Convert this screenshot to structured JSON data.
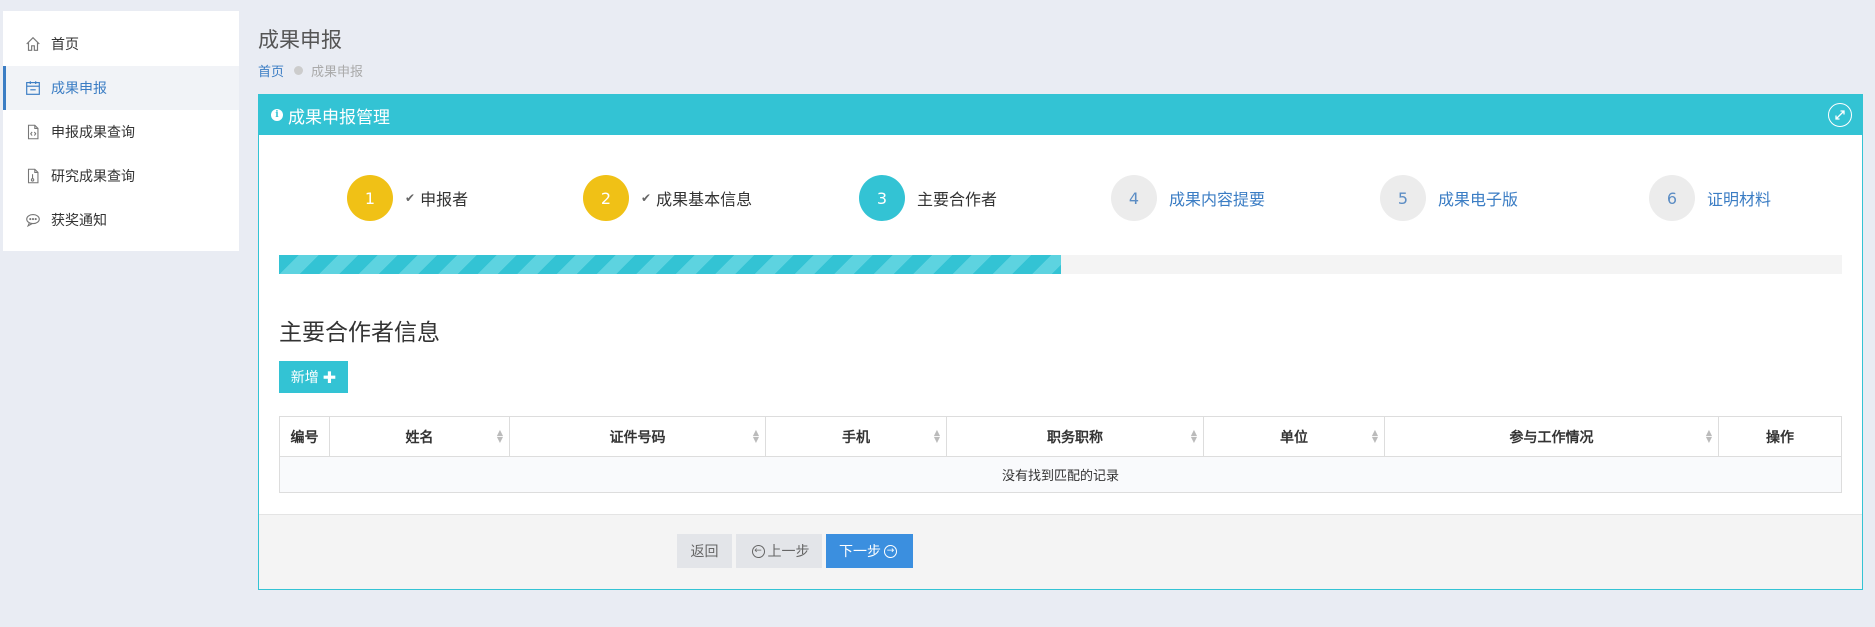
{
  "sidebar": {
    "items": [
      {
        "label": "首页",
        "icon": "home-icon"
      },
      {
        "label": "成果申报",
        "icon": "calendar-icon",
        "active": true
      },
      {
        "label": "申报成果查询",
        "icon": "code-file-icon"
      },
      {
        "label": "研究成果查询",
        "icon": "report-file-icon"
      },
      {
        "label": "获奖通知",
        "icon": "chat-bubble-icon"
      }
    ]
  },
  "header": {
    "title": "成果申报",
    "breadcrumb": {
      "home": "首页",
      "current": "成果申报"
    }
  },
  "panel": {
    "title": "成果申报管理",
    "steps": [
      {
        "num": "1",
        "label": "申报者",
        "state": "done"
      },
      {
        "num": "2",
        "label": "成果基本信息",
        "state": "done"
      },
      {
        "num": "3",
        "label": "主要合作者",
        "state": "current"
      },
      {
        "num": "4",
        "label": "成果内容提要",
        "state": "todo"
      },
      {
        "num": "5",
        "label": "成果电子版",
        "state": "todo"
      },
      {
        "num": "6",
        "label": "证明材料",
        "state": "todo"
      }
    ],
    "progress_percent": 50,
    "section_title": "主要合作者信息",
    "add_label": "新增",
    "table": {
      "columns": [
        "编号",
        "姓名",
        "证件号码",
        "手机",
        "职务职称",
        "单位",
        "参与工作情况",
        "操作"
      ],
      "empty_text": "没有找到匹配的记录"
    },
    "footer": {
      "back": "返回",
      "prev": "上一步",
      "next": "下一步"
    }
  },
  "colors": {
    "accent": "#33c3d4",
    "done": "#f0c116",
    "primary": "#3b8fdf",
    "link": "#3b7dc4"
  }
}
